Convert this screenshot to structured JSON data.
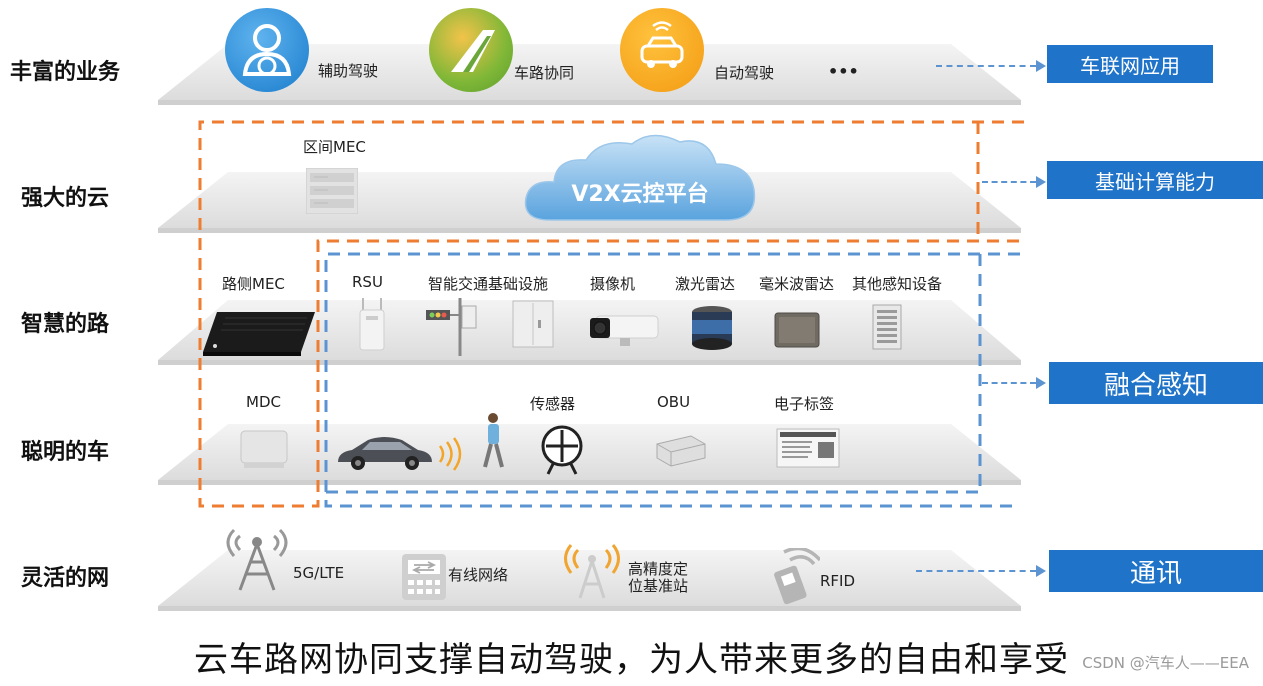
{
  "layers": {
    "business": {
      "title": "丰富的业务",
      "items": [
        "辅助驾驶",
        "车路协同",
        "自动驾驶"
      ],
      "more": "•••"
    },
    "cloud": {
      "title": "强大的云",
      "mec": "区间MEC",
      "platform": "V2X云控平台"
    },
    "road": {
      "title": "智慧的路",
      "mec": "路侧MEC",
      "items": [
        "RSU",
        "智能交通基础设施",
        "摄像机",
        "激光雷达",
        "毫米波雷达",
        "其他感知设备"
      ]
    },
    "vehicle": {
      "title": "聪明的车",
      "mdc": "MDC",
      "items": [
        "传感器",
        "OBU",
        "电子标签"
      ]
    },
    "network": {
      "title": "灵活的网",
      "items": [
        "5G/LTE",
        "有线网络",
        "高精度定",
        "位基准站",
        "RFID"
      ]
    }
  },
  "right_boxes": [
    "车联网应用",
    "基础计算能力",
    "融合感知",
    "通讯"
  ],
  "footer": "云车路网协同支撑自动驾驶，为人带来更多的自由和享受",
  "watermark": "CSDN @汽车人——EEA",
  "colors": {
    "blue_box": "#1f73c8",
    "orange_dash": "#ee7d31",
    "blue_dash": "#5b94d0",
    "layer_gray": "#e8e8e8"
  }
}
